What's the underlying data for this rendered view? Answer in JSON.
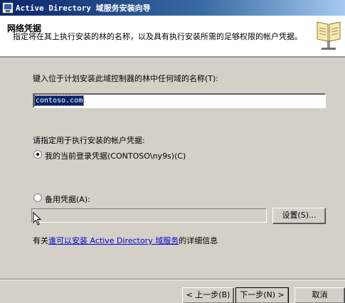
{
  "window": {
    "title": "Active Directory 域服务安装向导"
  },
  "header": {
    "title": "网络凭据",
    "description": "指定将在其上执行安装的林的名称，以及具有执行安装所需的足够权限的帐户凭据。"
  },
  "form": {
    "domain_prompt": "键入位于计划安装此域控制器的林中任何域的名称(T):",
    "domain_value": "contoso.com",
    "credentials_prompt": "请指定用于执行安装的帐户凭据:",
    "current_credentials": {
      "label": "我的当前登录凭据(CONTOSO\\ny9s)(C)",
      "selected": true
    },
    "alternate_credentials": {
      "label": "备用凭据(A):",
      "selected": false,
      "value": ""
    },
    "set_button": "设置(S)...",
    "info_prefix": "有关",
    "info_link": "谁可以安装 Active Directory 域服务",
    "info_suffix": "的详细信息"
  },
  "footer": {
    "back_button": "< 上一步(B)",
    "next_button": "下一步(N) >",
    "cancel_button": "取消"
  },
  "colors": {
    "title_bar_start": "#0a246a",
    "dialog_face": "#d4d0c8",
    "selection": "#0a246a",
    "link": "#0000cc"
  },
  "icons": {
    "app": "app-window-icon",
    "header": "directory-book-icon",
    "pointer": "mouse-cursor-icon"
  }
}
